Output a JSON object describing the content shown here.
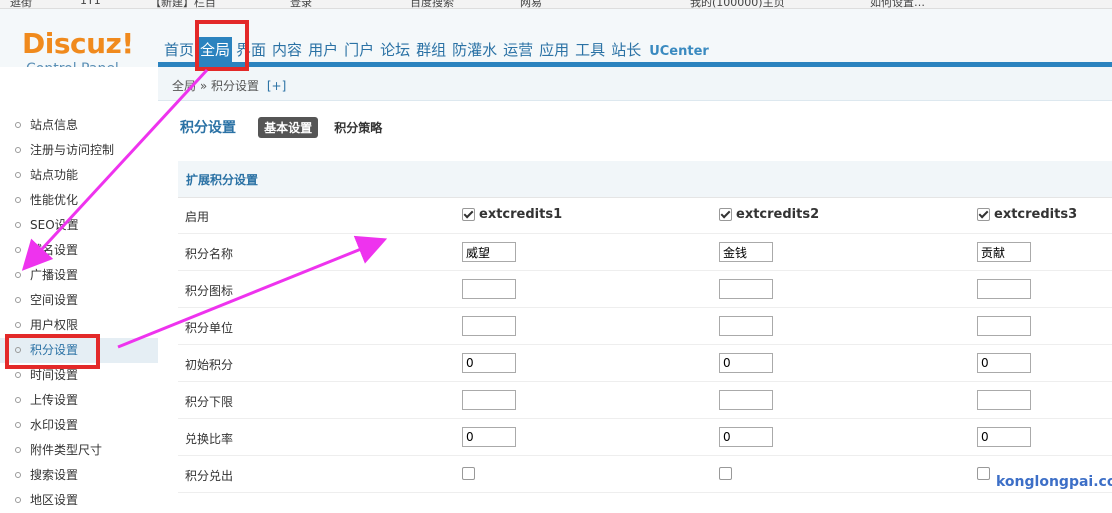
{
  "bookmarks": [
    "逛街",
    "1Y1",
    "【新建】栏目",
    "登录",
    "百度搜索",
    "网易",
    "我的(100000)主页",
    "如何设置…"
  ],
  "logo": {
    "brand": "Discuz!",
    "sub": "Control Panel"
  },
  "nav": {
    "items": [
      "首页",
      "全局",
      "界面",
      "内容",
      "用户",
      "门户",
      "论坛",
      "群组",
      "防灌水",
      "运营",
      "应用",
      "工具",
      "站长",
      "UCenter"
    ],
    "active_index": 1
  },
  "sidebar": {
    "items": [
      "站点信息",
      "注册与访问控制",
      "站点功能",
      "性能优化",
      "SEO设置",
      "域名设置",
      "广播设置",
      "空间设置",
      "用户权限",
      "积分设置",
      "时间设置",
      "上传设置",
      "水印设置",
      "附件类型尺寸",
      "搜索设置",
      "地区设置"
    ],
    "active_index": 9
  },
  "breadcrumb": {
    "root": "全局",
    "sep": "»",
    "current": "积分设置",
    "plus": "[+]"
  },
  "page": {
    "title": "积分设置",
    "tabs": [
      "基本设置",
      "积分策略"
    ],
    "active_tab": 0
  },
  "section": {
    "title": "扩展积分设置"
  },
  "columns": [
    {
      "name": "extcredits1",
      "enabled": true
    },
    {
      "name": "extcredits2",
      "enabled": true
    },
    {
      "name": "extcredits3",
      "enabled": true
    }
  ],
  "rows": [
    {
      "label": "启用",
      "kind": "enable"
    },
    {
      "label": "积分名称",
      "kind": "text",
      "values": [
        "威望",
        "金钱",
        "贡献"
      ]
    },
    {
      "label": "积分图标",
      "kind": "text",
      "values": [
        "",
        "",
        ""
      ]
    },
    {
      "label": "积分单位",
      "kind": "text",
      "values": [
        "",
        "",
        ""
      ]
    },
    {
      "label": "初始积分",
      "kind": "text",
      "values": [
        "0",
        "0",
        "0"
      ]
    },
    {
      "label": "积分下限",
      "kind": "text",
      "values": [
        "",
        "",
        ""
      ]
    },
    {
      "label": "兑换比率",
      "kind": "text",
      "values": [
        "0",
        "0",
        "0"
      ]
    },
    {
      "label": "积分兑出",
      "kind": "check",
      "values": [
        false,
        false,
        false
      ]
    }
  ],
  "watermark": "konglongpai.com",
  "colors": {
    "accent": "#2b83bf",
    "highlight": "#e32929",
    "arrow": "#ee33ee",
    "logo": "#f08a1d"
  }
}
